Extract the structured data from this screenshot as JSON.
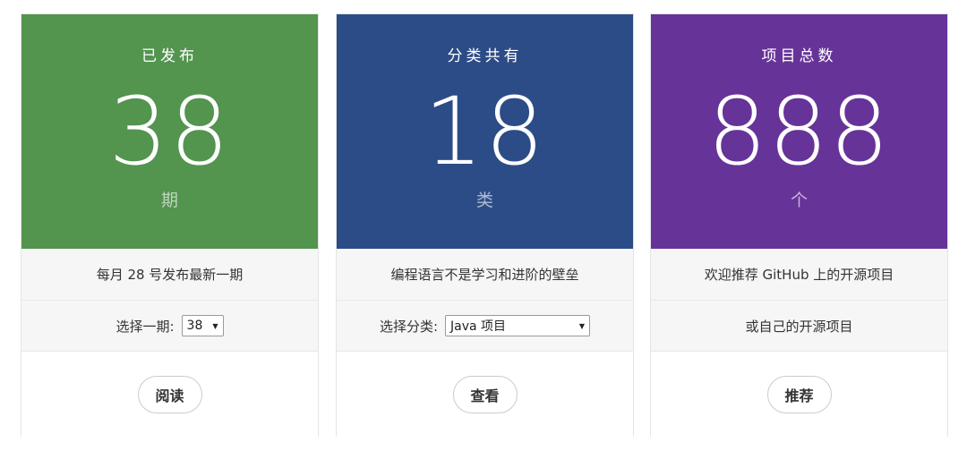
{
  "cards": [
    {
      "color": "#53944f",
      "label": "已发布",
      "number": "38",
      "unit": "期",
      "description": "每月 28 号发布最新一期",
      "select_label": "选择一期:",
      "select_value": "38",
      "button": "阅读"
    },
    {
      "color": "#2c4c87",
      "label": "分类共有",
      "number": "18",
      "unit": "类",
      "description": "编程语言不是学习和进阶的壁垒",
      "select_label": "选择分类:",
      "select_value": "Java 项目",
      "button": "查看"
    },
    {
      "color": "#663399",
      "label": "项目总数",
      "number": "888",
      "unit": "个",
      "description": "欢迎推荐 GitHub 上的开源项目",
      "note": "或自己的开源项目",
      "button": "推荐"
    }
  ],
  "icons": {
    "dropdown": "chevron-down-icon"
  }
}
